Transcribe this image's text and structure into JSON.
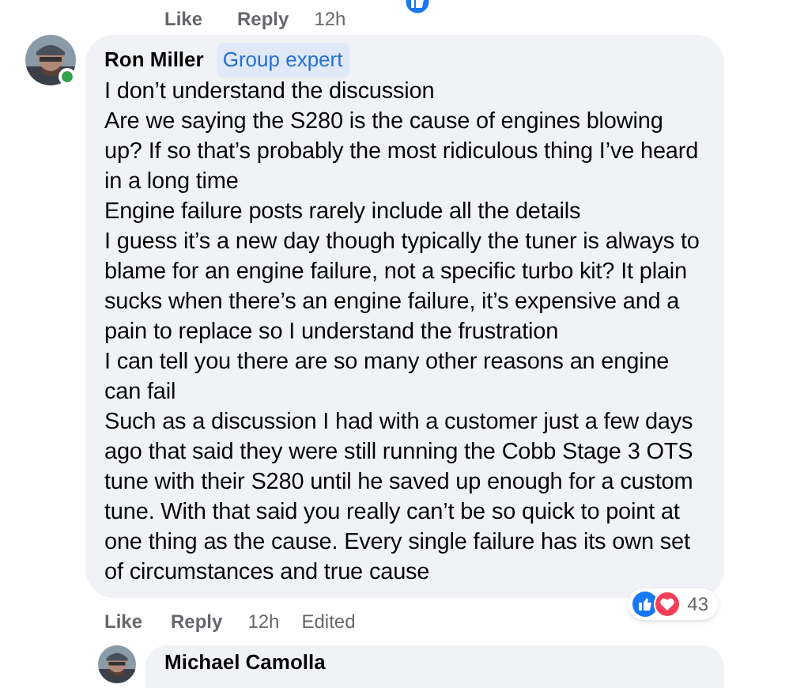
{
  "previous_comment": {
    "actions": [
      "Like",
      "Reply"
    ],
    "time": "12h"
  },
  "comment": {
    "author": "Ron Miller",
    "badge": "Group expert",
    "online": true,
    "paragraphs": [
      "I don’t understand the discussion",
      "Are we saying the S280 is the cause of engines blowing up? If so that’s probably the most ridiculous thing I’ve heard in a long time",
      "Engine failure posts rarely include all the details",
      "I guess it’s a new day though typically the tuner is always to blame for an engine failure, not a specific turbo kit? It plain sucks when there’s an engine failure, it’s expensive and a pain to replace so I understand the frustration",
      "I can tell you there are so many other reasons an engine can fail",
      "Such as a discussion I had with a customer just a few days ago that said they were still running the Cobb Stage 3 OTS tune with their S280 until he saved up enough for a custom tune. With that said you really can’t be so quick to point at one thing as the cause. Every single failure has its own set of circumstances and true cause"
    ],
    "actions": [
      "Like",
      "Reply"
    ],
    "time": "12h",
    "edited": "Edited",
    "reaction_count": "43"
  },
  "next_comment": {
    "author": "Michael Camolla"
  }
}
